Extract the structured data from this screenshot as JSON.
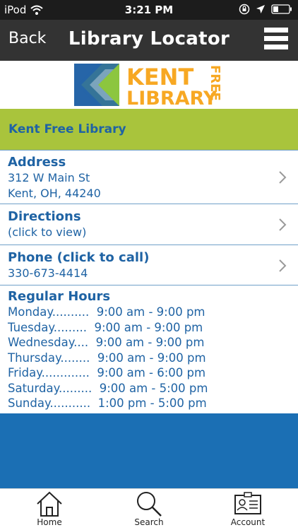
{
  "status_bar": {
    "carrier": "iPod",
    "time": "3:21 PM",
    "icons": [
      "wifi-icon",
      "orientation-lock-icon",
      "location-icon",
      "battery-icon"
    ]
  },
  "nav": {
    "back_label": "Back",
    "title": "Library Locator",
    "menu_icon": "hamburger-icon"
  },
  "logo": {
    "word1": "KENT",
    "word2": "LIBRARY",
    "word3": "FREE",
    "colors": {
      "blue": "#2665a8",
      "green": "#8cc63f",
      "orange": "#f7a823"
    }
  },
  "library": {
    "name": "Kent Free Library"
  },
  "address": {
    "title": "Address",
    "line1": "312 W Main St",
    "line2": "Kent, OH, 44240"
  },
  "directions": {
    "title": "Directions",
    "line1": "(click to view)"
  },
  "phone": {
    "title": "Phone (click to call)",
    "line1": "330-673-4414"
  },
  "hours": {
    "title": "Regular Hours",
    "lines": [
      "Monday..........  9:00 am - 9:00 pm",
      "Tuesday.........  9:00 am - 9:00 pm",
      "Wednesday....  9:00 am - 9:00 pm",
      "Thursday........  9:00 am - 9:00 pm",
      "Friday.............  9:00 am - 6:00 pm",
      "Saturday.........  9:00 am - 5:00 pm",
      "Sunday...........  1:00 pm - 5:00 pm"
    ]
  },
  "tabs": [
    {
      "label": "Home",
      "icon": "home-icon"
    },
    {
      "label": "Search",
      "icon": "search-icon"
    },
    {
      "label": "Account",
      "icon": "id-card-icon"
    }
  ],
  "colors": {
    "nav_bg": "#333333",
    "green": "#a9c43c",
    "text_blue": "#1f63a4",
    "band_blue": "#1b6fb4"
  }
}
